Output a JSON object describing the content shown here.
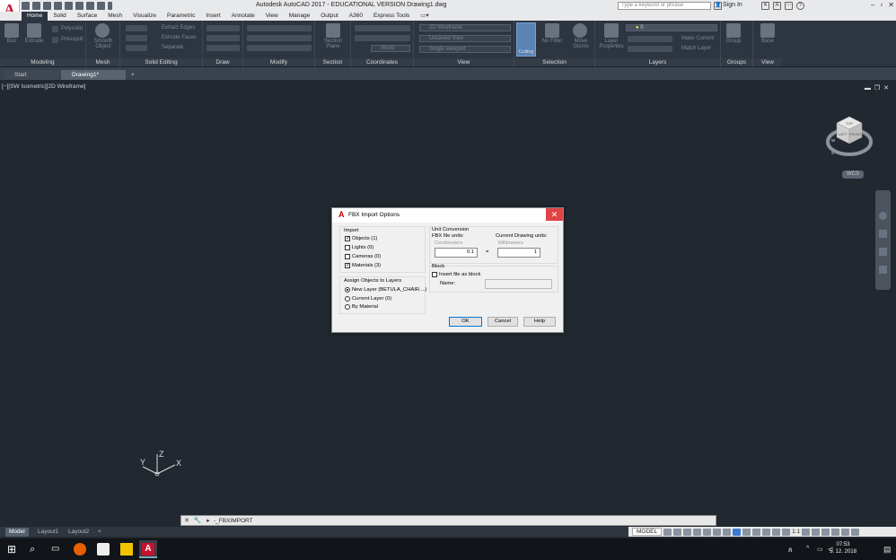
{
  "app": {
    "title": "Autodesk AutoCAD 2017 - EDUCATIONAL VERSION    Drawing1.dwg",
    "search_placeholder": "Type a keyword or phrase",
    "sign_in": "Sign In",
    "logo_letter": "A"
  },
  "ribbon_tabs": [
    "Home",
    "Solid",
    "Surface",
    "Mesh",
    "Visualize",
    "Parametric",
    "Insert",
    "Annotate",
    "View",
    "Manage",
    "Output",
    "A360",
    "Express Tools"
  ],
  "ribbon_panels": {
    "modeling": "Modeling",
    "mesh": "Mesh",
    "solid_editing": "Solid Editing",
    "draw": "Draw",
    "modify": "Modify",
    "section": "Section",
    "coordinates": "Coordinates",
    "view": "View",
    "selection": "Selection",
    "layers": "Layers",
    "groups": "Groups",
    "view2": "View"
  },
  "ribbon_items": {
    "box": "Box",
    "extrude": "Extrude",
    "polysolid": "Polysolid",
    "presspull": "Presspull",
    "smooth_object": "Smooth Object",
    "extract_edges": "Extract Edges",
    "extrude_faces": "Extrude Faces",
    "separate": "Separate",
    "section_plane": "Section Plane",
    "visual_style": "2D Wireframe",
    "unsaved_view": "Unsaved View",
    "single_viewport": "Single viewport",
    "world": "World",
    "culling": "Culling",
    "no_filter": "No Filter",
    "move_gizmo": "Move Gizmo",
    "layer_properties": "Layer Properties",
    "make_current": "Make Current",
    "match_layer": "Match Layer",
    "layer_name": "0",
    "group": "Group",
    "base": "Base"
  },
  "doc_tabs": [
    "Start",
    "Drawing1*"
  ],
  "viewport_label": "[−][SW Isometric][2D Wireframe]",
  "viewcube": {
    "top": "TOP",
    "left": "LEFT",
    "front": "FRONT",
    "n": "N",
    "s": "S",
    "w": "W",
    "wcs": "WCS"
  },
  "ucs": {
    "x": "X",
    "y": "Y",
    "z": "Z"
  },
  "dialog": {
    "title": "FBX Import Options",
    "import_header": "Import",
    "objects": "Objects (1)",
    "lights": "Lights (0)",
    "cameras": "Cameras (0)",
    "materials": "Materials (3)",
    "assign_header": "Assign Objects to Layers",
    "new_layer": "New Layer (BETULA_CHAIR....)",
    "current_layer": "Current Layer (0)",
    "by_material": "By Material",
    "unit_header": "Unit Conversion",
    "fbx_units_label": "FBX file units:",
    "fbx_units_value": "Centimeters",
    "drawing_units_label": "Current Drawing units:",
    "drawing_units_value": "Millimeters",
    "fbx_scale": "0.1",
    "equals": "=",
    "drawing_scale": "1",
    "block_header": "Block",
    "insert_as_block": "Insert file as block",
    "name_label": "Name:",
    "ok": "OK",
    "cancel": "Cancel",
    "help": "Help",
    "checks": {
      "objects": true,
      "lights": false,
      "cameras": false,
      "materials": true,
      "insert_as_block": false
    },
    "radio_selected": "new_layer"
  },
  "layout_tabs": [
    "Model",
    "Layout1",
    "Layout2"
  ],
  "command_line": "_FBXIMPORT",
  "status": {
    "model": "MODEL",
    "scale": "1:1"
  },
  "clock": {
    "time": "07:53",
    "date": "5. 12. 2018"
  },
  "colors": {
    "canvas": "#212830",
    "ribbon": "#2d3540",
    "close_red": "#e04343",
    "autocad_red": "#c8102e"
  }
}
